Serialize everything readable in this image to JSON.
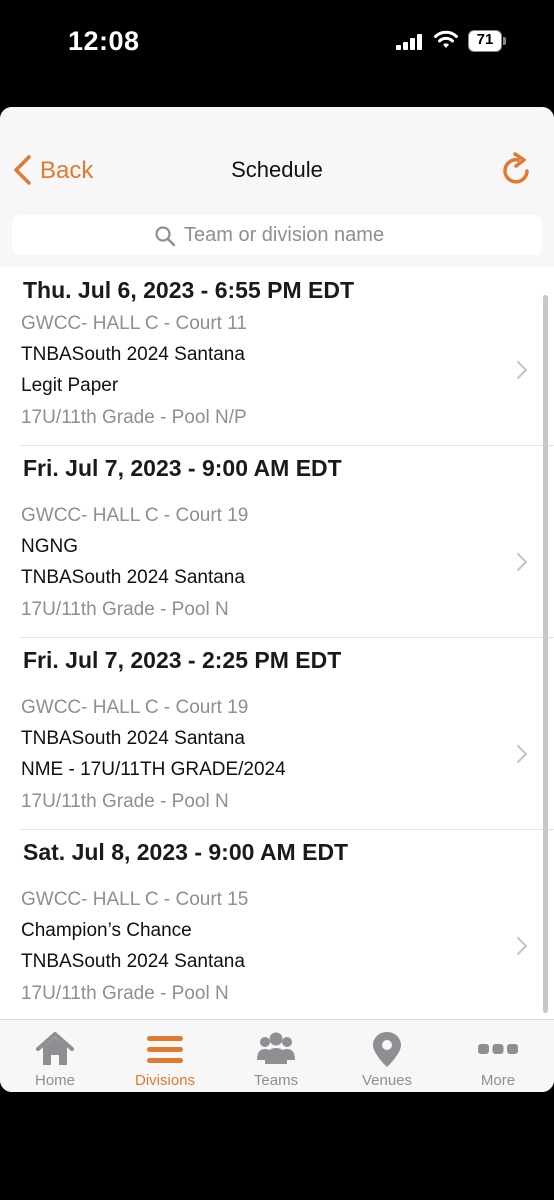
{
  "status_bar": {
    "time": "12:08",
    "battery": "71"
  },
  "nav": {
    "back_label": "Back",
    "title": "Schedule"
  },
  "search": {
    "placeholder": "Team or division name"
  },
  "colors": {
    "accent": "#e07a2f",
    "gray_text": "#8e8e93"
  },
  "games": [
    {
      "date": "Thu. Jul 6, 2023 - 6:55 PM EDT",
      "venue": "GWCC- HALL C - Court 11",
      "team1": "TNBASouth 2024 Santana",
      "team2": "Legit Paper",
      "division": "17U/11th Grade - Pool N/P"
    },
    {
      "date": "Fri. Jul 7, 2023 - 9:00 AM EDT",
      "venue": "GWCC- HALL C - Court 19",
      "team1": "NGNG",
      "team2": "TNBASouth 2024 Santana",
      "division": "17U/11th Grade - Pool N"
    },
    {
      "date": "Fri. Jul 7, 2023 - 2:25 PM EDT",
      "venue": "GWCC- HALL C - Court 19",
      "team1": "TNBASouth 2024 Santana",
      "team2": "NME - 17U/11TH GRADE/2024",
      "division": "17U/11th Grade - Pool N"
    },
    {
      "date": "Sat. Jul 8, 2023 - 9:00 AM EDT",
      "venue": "GWCC- HALL C - Court 15",
      "team1": "Champion’s Chance",
      "team2": "TNBASouth 2024 Santana",
      "division": "17U/11th Grade - Pool N"
    }
  ],
  "tabs": [
    {
      "label": "Home",
      "icon": "home-icon",
      "active": false
    },
    {
      "label": "Divisions",
      "icon": "menu-icon",
      "active": true
    },
    {
      "label": "Teams",
      "icon": "people-icon",
      "active": false
    },
    {
      "label": "Venues",
      "icon": "location-pin-icon",
      "active": false
    },
    {
      "label": "More",
      "icon": "more-dots-icon",
      "active": false
    }
  ]
}
